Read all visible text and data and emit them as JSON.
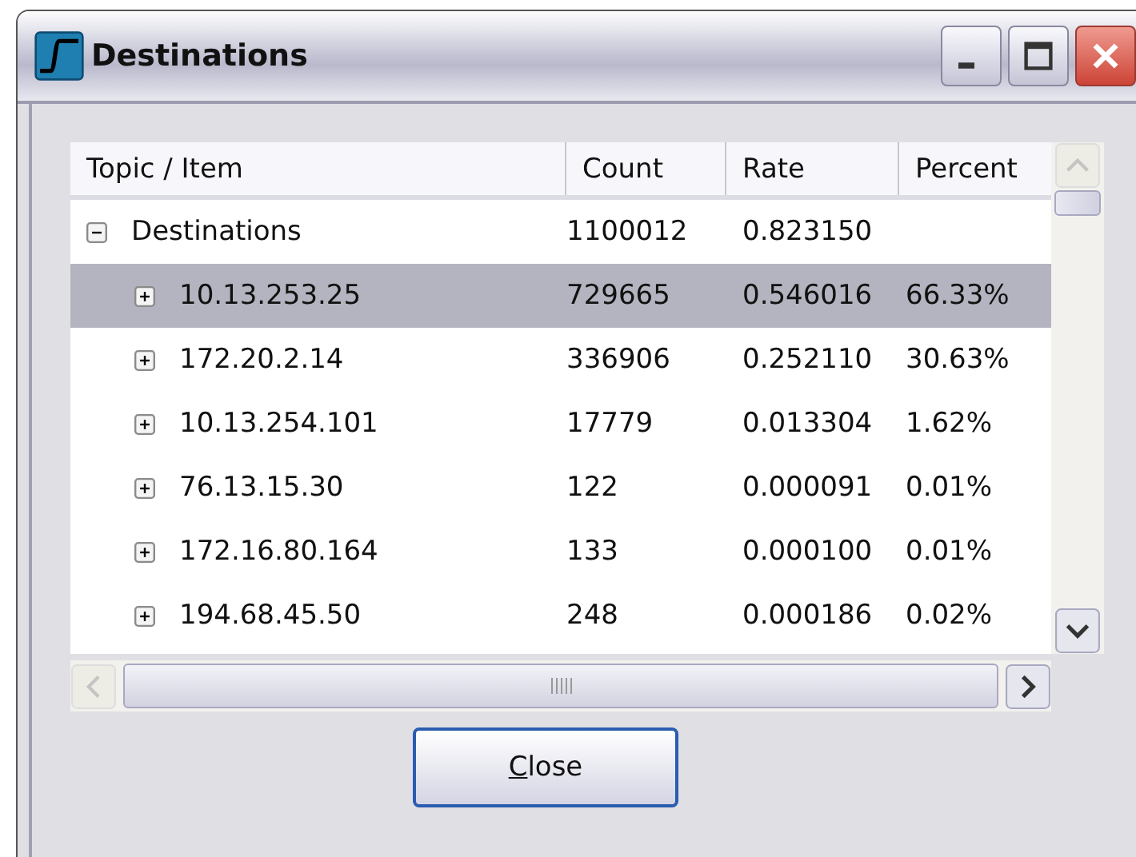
{
  "window": {
    "title": "Destinations"
  },
  "columns": [
    "Topic / Item",
    "Count",
    "Rate",
    "Percent"
  ],
  "tree": [
    {
      "label": "Destinations",
      "count": "1100012",
      "rate": "0.823150",
      "expanded": true,
      "selected": false,
      "children": [
        {
          "label": "10.13.253.25",
          "count": "729665",
          "rate": "0.546016",
          "percent": "66.33%",
          "expanded": false,
          "selected": true
        },
        {
          "label": "172.20.2.14",
          "count": "336906",
          "rate": "0.252110",
          "percent": "30.63%",
          "expanded": false,
          "selected": false
        },
        {
          "label": "10.13.254.101",
          "count": "17779",
          "rate": "0.013304",
          "percent": "1.62%",
          "expanded": false,
          "selected": false
        },
        {
          "label": "76.13.15.30",
          "count": "122",
          "rate": "0.000091",
          "percent": "0.01%",
          "expanded": false,
          "selected": false
        },
        {
          "label": "172.16.80.164",
          "count": "133",
          "rate": "0.000100",
          "percent": "0.01%",
          "expanded": false,
          "selected": false
        },
        {
          "label": "194.68.45.50",
          "count": "248",
          "rate": "0.000186",
          "percent": "0.02%",
          "expanded": false,
          "selected": false
        }
      ]
    }
  ],
  "buttons": [
    "Close"
  ]
}
